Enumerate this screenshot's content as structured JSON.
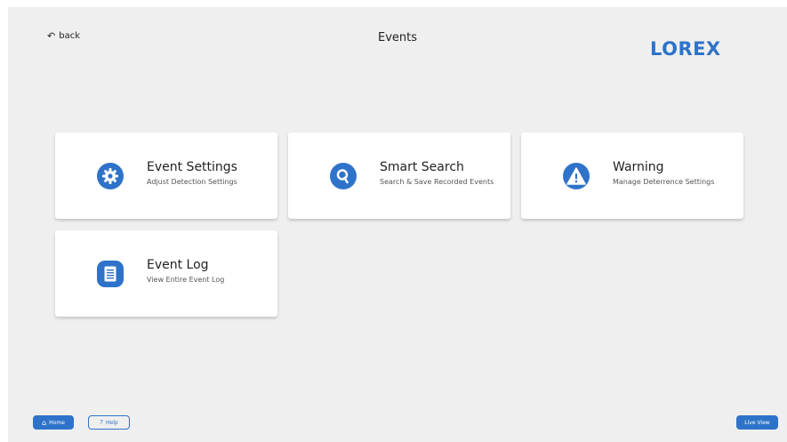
{
  "header": {
    "back_label": "back",
    "title": "Events",
    "logo_text": "LOREX"
  },
  "cards": [
    {
      "label": "Event Settings",
      "sub": "Adjust Detection Settings",
      "icon": "gear-icon"
    },
    {
      "label": "Smart Search",
      "sub": "Search & Save Recorded Events",
      "icon": "search-icon"
    },
    {
      "label": "Warning",
      "sub": "Manage Deterrence Settings",
      "icon": "warning-icon"
    },
    {
      "label": "Event Log",
      "sub": "View Entire Event Log",
      "icon": "document-icon"
    }
  ],
  "footer": {
    "home_label": "Home",
    "help_label": "Help",
    "live_view_label": "Live View"
  },
  "colors": {
    "accent": "#2e73c9",
    "background": "#efefef",
    "card": "#ffffff"
  }
}
